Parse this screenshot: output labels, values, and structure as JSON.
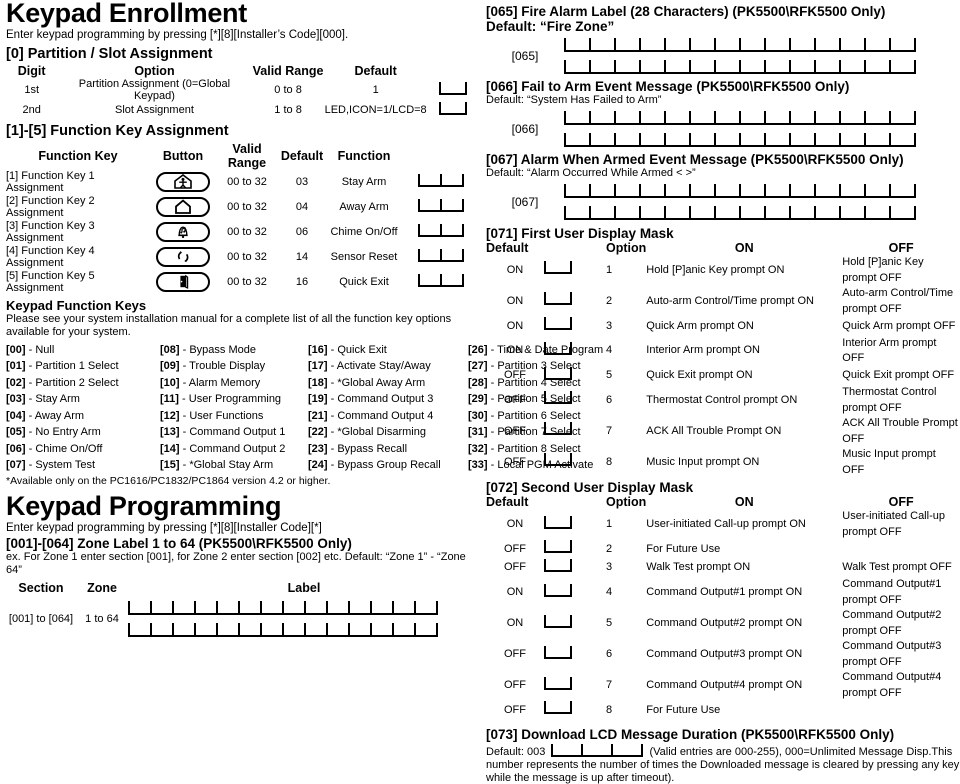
{
  "left": {
    "title": "Keypad Enrollment",
    "intro": "Enter keypad programming by pressing [*][8][Installer’s Code][000].",
    "partition_section": {
      "heading": "[0] Partition / Slot Assignment",
      "columns": [
        "Digit",
        "Option",
        "Valid Range",
        "Default"
      ],
      "rows": [
        {
          "digit": "1st",
          "option": "Partition Assignment (0=Global Keypad)",
          "range": "0 to 8",
          "default": "1",
          "cells": 1
        },
        {
          "digit": "2nd",
          "option": "Slot Assignment",
          "range": "1 to 8",
          "default": "LED,ICON=1/LCD=8",
          "cells": 1
        }
      ]
    },
    "function_key_section": {
      "heading": "[1]-[5] Function Key Assignment",
      "columns": [
        "Function Key",
        "Button",
        "Valid Range",
        "Default",
        "Function"
      ],
      "rows": [
        {
          "key": "[1] Function Key 1 Assignment",
          "icon": "person-in-house-icon",
          "range": "00 to 32",
          "default": "03",
          "function": "Stay Arm"
        },
        {
          "key": "[2] Function Key 2 Assignment",
          "icon": "house-icon",
          "range": "00 to 32",
          "default": "04",
          "function": "Away Arm"
        },
        {
          "key": "[3] Function Key 3 Assignment",
          "icon": "bell-music-icon",
          "range": "00 to 32",
          "default": "06",
          "function": "Chime On/Off"
        },
        {
          "key": "[4] Function Key 4 Assignment",
          "icon": "circular-arrows-icon",
          "range": "00 to 32",
          "default": "14",
          "function": "Sensor Reset"
        },
        {
          "key": "[5] Function Key 5 Assignment",
          "icon": "door-exit-icon",
          "range": "00 to 32",
          "default": "16",
          "function": "Quick Exit"
        }
      ]
    },
    "keypad_function_keys": {
      "heading": "Keypad Function Keys",
      "note": "Please see your system installation manual for a complete list of all the function key options available for your system.",
      "options_col1": [
        {
          "code": "[00]",
          "label": "- Null"
        },
        {
          "code": "[01]",
          "label": "- Partition 1 Select"
        },
        {
          "code": "[02]",
          "label": "- Partition 2 Select"
        },
        {
          "code": "[03]",
          "label": "- Stay Arm"
        },
        {
          "code": "[04]",
          "label": "- Away Arm"
        },
        {
          "code": "[05]",
          "label": "- No Entry Arm"
        },
        {
          "code": "[06]",
          "label": "- Chime On/Off"
        },
        {
          "code": "[07]",
          "label": "- System Test"
        }
      ],
      "options_col2": [
        {
          "code": "[08]",
          "label": "- Bypass Mode"
        },
        {
          "code": "[09]",
          "label": "- Trouble Display"
        },
        {
          "code": "[10]",
          "label": "- Alarm Memory"
        },
        {
          "code": "[11]",
          "label": "- User Programming"
        },
        {
          "code": "[12]",
          "label": "- User Functions"
        },
        {
          "code": "[13]",
          "label": "- Command Output 1"
        },
        {
          "code": "[14]",
          "label": "- Command Output 2"
        },
        {
          "code": "[15]",
          "label": "- *Global Stay Arm"
        }
      ],
      "options_col3": [
        {
          "code": "[16]",
          "label": "- Quick Exit"
        },
        {
          "code": "[17]",
          "label": "- Activate Stay/Away"
        },
        {
          "code": "[18]",
          "label": "- *Global Away Arm"
        },
        {
          "code": "[19]",
          "label": "- Command Output 3"
        },
        {
          "code": "[21]",
          "label": "- Command Output 4"
        },
        {
          "code": "[22]",
          "label": "- *Global Disarming"
        },
        {
          "code": "[23]",
          "label": "- Bypass Recall"
        },
        {
          "code": "[24]",
          "label": "- Bypass Group Recall"
        }
      ],
      "options_col4": [
        {
          "code": "[26]",
          "label": "- Time & Date Program"
        },
        {
          "code": "[27]",
          "label": "- Partition 3 Select"
        },
        {
          "code": "[28]",
          "label": "- Partition 4 Select"
        },
        {
          "code": "[29]",
          "label": "- Partition 5 Select"
        },
        {
          "code": "[30]",
          "label": "- Partition 6 Select"
        },
        {
          "code": "[31]",
          "label": "- Partition 7 Select"
        },
        {
          "code": "[32]",
          "label": "- Partition 8 Select"
        },
        {
          "code": "[33]",
          "label": "- Local PGM Activate"
        }
      ],
      "footnote": "*Available only on the PC1616/PC1832/PC1864 version 4.2 or higher."
    },
    "programming": {
      "title": "Keypad Programming",
      "intro": "Enter keypad programming by pressing [*][8][Installer Code][*]",
      "zone_label_heading": "[001]-[064] Zone Label 1 to 64 (PK5500\\RFK5500 Only)",
      "zone_label_note": "ex. For Zone 1 enter section [001], for Zone 2 enter section [002] etc. Default: “Zone 1”  - “Zone 64”",
      "columns": [
        "Section",
        "Zone",
        "Label"
      ],
      "row": {
        "section": "[001] to [064]",
        "zone": "1 to 64",
        "cells_per_row": 14,
        "rows": 2
      }
    }
  },
  "right": {
    "s065": {
      "heading": "[065] Fire Alarm Label (28 Characters) (PK5500\\RFK5500 Only)",
      "default": "Default: “Fire Zone”",
      "tag": "[065]",
      "cells_per_row": 14,
      "rows": 2
    },
    "s066": {
      "heading": "[066] Fail to Arm Event Message (PK5500\\RFK5500 Only)",
      "default": "Default: “System Has Failed to Arm”",
      "tag": "[066]",
      "cells_per_row": 14,
      "rows": 2
    },
    "s067": {
      "heading": "[067] Alarm When Armed Event Message (PK5500\\RFK5500 Only)",
      "default": "Default: “Alarm Occurred While Armed < >”",
      "tag": "[067]",
      "cells_per_row": 14,
      "rows": 2
    },
    "s071": {
      "heading": "[071]  First User Display Mask",
      "columns": [
        "Default",
        "Option",
        "ON",
        "OFF"
      ],
      "rows": [
        {
          "default": "ON",
          "n": "1",
          "on": "Hold [P]anic Key prompt ON",
          "off": "Hold [P]anic Key prompt OFF"
        },
        {
          "default": "ON",
          "n": "2",
          "on": "Auto-arm Control/Time prompt ON",
          "off": "Auto-arm Control/Time prompt OFF"
        },
        {
          "default": "ON",
          "n": "3",
          "on": "Quick Arm prompt ON",
          "off": "Quick Arm prompt OFF"
        },
        {
          "default": "ON",
          "n": "4",
          "on": "Interior Arm prompt ON",
          "off": "Interior Arm prompt OFF"
        },
        {
          "default": "OFF",
          "n": "5",
          "on": "Quick Exit prompt ON",
          "off": "Quick Exit prompt OFF"
        },
        {
          "default": "OFF",
          "n": "6",
          "on": "Thermostat Control prompt ON",
          "off": "Thermostat Control prompt OFF"
        },
        {
          "default": "OFF",
          "n": "7",
          "on": "ACK All Trouble Prompt ON",
          "off": "ACK All Trouble Prompt OFF"
        },
        {
          "default": "OFF",
          "n": "8",
          "on": "Music Input prompt ON",
          "off": "Music Input prompt OFF"
        }
      ]
    },
    "s072": {
      "heading": "[072] Second User Display Mask",
      "columns": [
        "Default",
        "Option",
        "ON",
        "OFF"
      ],
      "rows": [
        {
          "default": "ON",
          "n": "1",
          "on": "User-initiated Call-up prompt ON",
          "off": "User-initiated Call-up prompt OFF"
        },
        {
          "default": "OFF",
          "n": "2",
          "on": "For Future Use",
          "off": ""
        },
        {
          "default": "OFF",
          "n": "3",
          "on": "Walk Test prompt ON",
          "off": "Walk Test prompt OFF"
        },
        {
          "default": "ON",
          "n": "4",
          "on": "Command Output#1 prompt ON",
          "off": "Command Output#1 prompt OFF"
        },
        {
          "default": "ON",
          "n": "5",
          "on": "Command Output#2 prompt ON",
          "off": "Command Output#2 prompt OFF"
        },
        {
          "default": "OFF",
          "n": "6",
          "on": "Command Output#3 prompt ON",
          "off": "Command Output#3 prompt OFF"
        },
        {
          "default": "OFF",
          "n": "7",
          "on": "Command Output#4 prompt ON",
          "off": "Command Output#4 prompt OFF"
        },
        {
          "default": "OFF",
          "n": "8",
          "on": "For Future Use",
          "off": ""
        }
      ]
    },
    "s073": {
      "heading": "[073] Download LCD Message Duration (PK5500\\RFK5500 Only)",
      "default_prefix": "Default: 003",
      "body": "(Valid entries are 000-255), 000=Unlimited Message Disp.This number represents the number of times the Downloaded message is cleared by pressing any key while the message is up after timeout).",
      "cells": 3
    }
  }
}
